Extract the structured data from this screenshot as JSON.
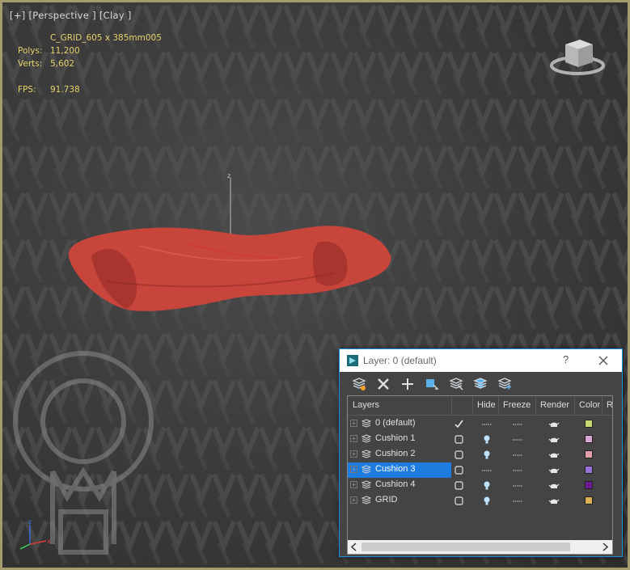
{
  "viewport": {
    "label": "[+] [Perspective ] [Clay ]",
    "object_name": "C_GRID_605 x 385mm005",
    "polys_key": "Polys:",
    "polys_val": "11,200",
    "verts_key": "Verts:",
    "verts_val": "5,602",
    "fps_key": "FPS:",
    "fps_val": "91.738",
    "gizmo_axis": "z",
    "border_color": "#a59c6e",
    "stats_color": "#e6d36a",
    "object_color": "#c8453c"
  },
  "dialog": {
    "title": "Layer: 0 (default)",
    "help": "?",
    "toolbar_icons": [
      "new-layer-icon",
      "delete-layer-icon",
      "add-to-layer-icon",
      "select-objects-icon",
      "highlight-layer-icon",
      "hide-all-icon",
      "freeze-all-icon"
    ],
    "columns": {
      "layers": "Layers",
      "hide": "Hide",
      "freeze": "Freeze",
      "render": "Render",
      "color": "Color",
      "radiosity": "R"
    },
    "layers": [
      {
        "name": "0 (default)",
        "current": true,
        "hidden": false,
        "color": "#c6d86f"
      },
      {
        "name": "Cushion 1",
        "current": false,
        "hidden": true,
        "color": "#d8a6d8"
      },
      {
        "name": "Cushion 2",
        "current": false,
        "hidden": true,
        "color": "#e0a0a6"
      },
      {
        "name": "Cushion 3",
        "current": false,
        "hidden": false,
        "selected": true,
        "color": "#9a6fd8"
      },
      {
        "name": "Cushion 4",
        "current": false,
        "hidden": true,
        "color": "#6a1a9a"
      },
      {
        "name": "GRID",
        "current": false,
        "hidden": true,
        "color": "#d8b450"
      }
    ]
  }
}
